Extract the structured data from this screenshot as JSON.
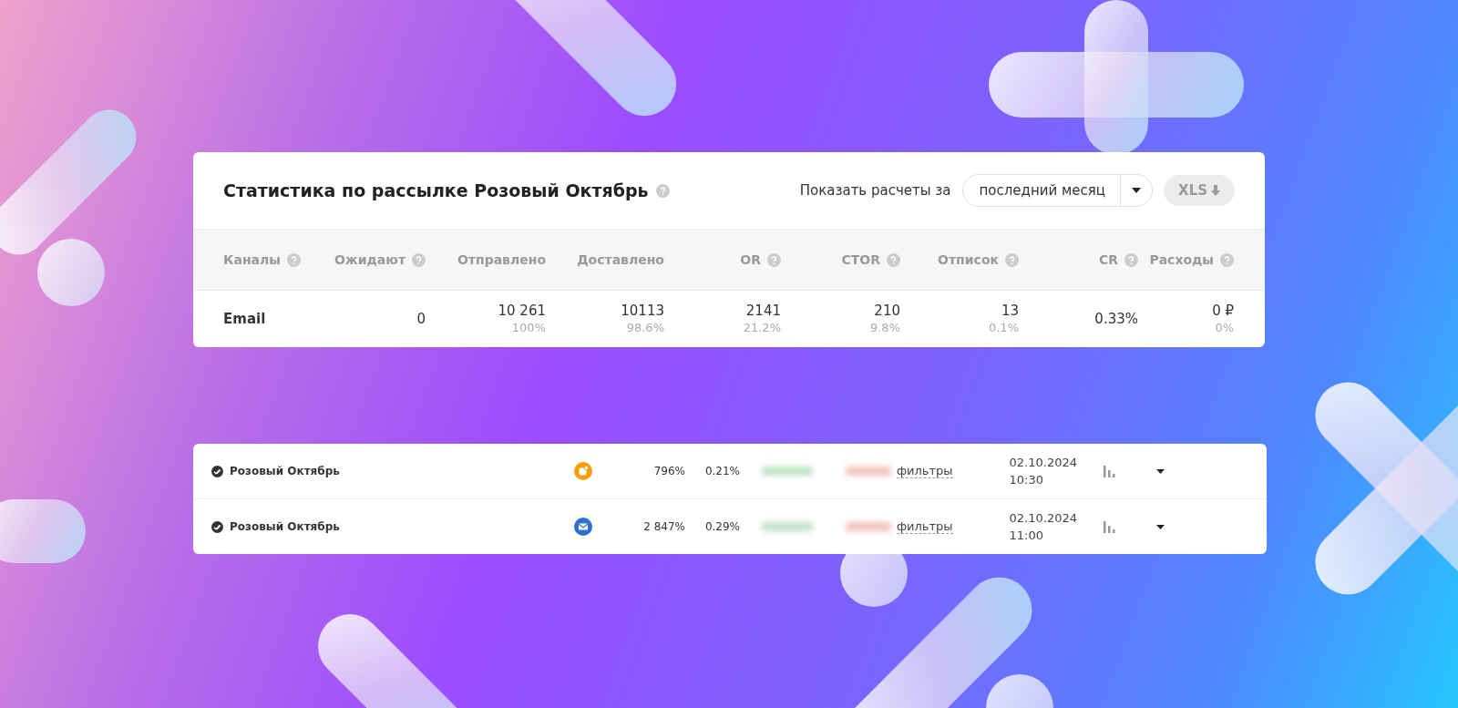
{
  "stats": {
    "title": "Статистика по рассылке Розовый Октябрь",
    "period_label": "Показать расчеты за",
    "period_select": {
      "value": "последний месяц"
    },
    "export_button": {
      "label": "XLS"
    },
    "columns": [
      {
        "label": "Каналы",
        "help": true
      },
      {
        "label": "Ожидают",
        "help": true
      },
      {
        "label": "Отправлено",
        "help": false
      },
      {
        "label": "Доставлено",
        "help": false
      },
      {
        "label": "OR",
        "help": true
      },
      {
        "label": "CTOR",
        "help": true
      },
      {
        "label": "Отписок",
        "help": true
      },
      {
        "label": "CR",
        "help": true
      },
      {
        "label": "Расходы",
        "help": true
      }
    ],
    "rows": [
      {
        "cells": [
          {
            "value": "Email"
          },
          {
            "value": "0"
          },
          {
            "value": "10 261",
            "share": "100%"
          },
          {
            "value": "10113",
            "share": "98.6%"
          },
          {
            "value": "2141",
            "share": "21.2%"
          },
          {
            "value": "210",
            "share": "9.8%"
          },
          {
            "value": "13",
            "share": "0.1%"
          },
          {
            "value": "0.33%"
          },
          {
            "value": "0 ₽",
            "share": "0%"
          }
        ]
      }
    ]
  },
  "campaigns": [
    {
      "name": "Розовый Октябрь",
      "kind": "push",
      "metric_1": "796%",
      "metric_2": "0.21%",
      "link": "фильтры",
      "date": "02.10.2024",
      "time": "10:30"
    },
    {
      "name": "Розовый Октябрь",
      "kind": "email",
      "metric_1": "2 847%",
      "metric_2": "0.29%",
      "link": "фильтры",
      "date": "02.10.2024",
      "time": "11:00"
    }
  ]
}
